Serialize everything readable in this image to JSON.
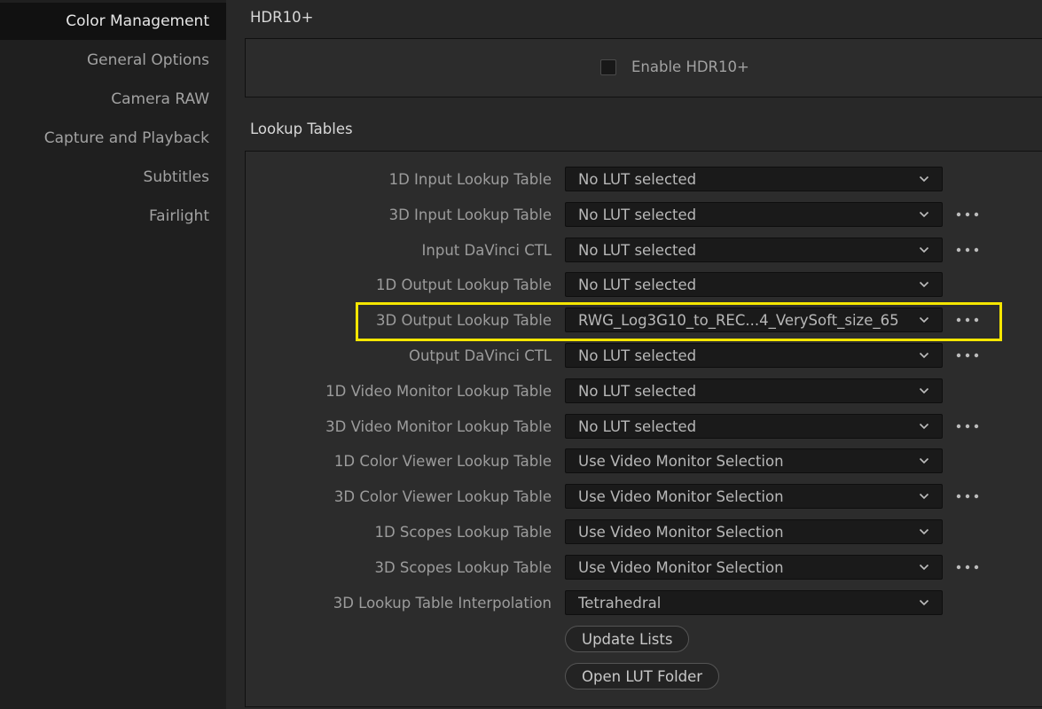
{
  "sidebar": {
    "items": [
      {
        "label": "Color Management",
        "active": true
      },
      {
        "label": "General Options"
      },
      {
        "label": "Camera RAW"
      },
      {
        "label": "Capture and Playback"
      },
      {
        "label": "Subtitles"
      },
      {
        "label": "Fairlight"
      }
    ]
  },
  "hdr": {
    "title": "HDR10+",
    "checkbox_label": "Enable HDR10+",
    "checked": false
  },
  "lut": {
    "title": "Lookup Tables",
    "rows": [
      {
        "label": "1D Input Lookup Table",
        "value": "No LUT selected",
        "has_more": false
      },
      {
        "label": "3D Input Lookup Table",
        "value": "No LUT selected",
        "has_more": true
      },
      {
        "label": "Input DaVinci CTL",
        "value": "No LUT selected",
        "has_more": true
      },
      {
        "label": "1D Output Lookup Table",
        "value": "No LUT selected",
        "has_more": false
      },
      {
        "label": "3D Output Lookup Table",
        "value": "RWG_Log3G10_to_REC...4_VerySoft_size_65",
        "has_more": true,
        "highlighted": true
      },
      {
        "label": "Output DaVinci CTL",
        "value": "No LUT selected",
        "has_more": true
      },
      {
        "label": "1D Video Monitor Lookup Table",
        "value": "No LUT selected",
        "has_more": false
      },
      {
        "label": "3D Video Monitor Lookup Table",
        "value": "No LUT selected",
        "has_more": true
      },
      {
        "label": "1D Color Viewer Lookup Table",
        "value": "Use Video Monitor Selection",
        "has_more": false
      },
      {
        "label": "3D Color Viewer Lookup Table",
        "value": "Use Video Monitor Selection",
        "has_more": true
      },
      {
        "label": "1D Scopes Lookup Table",
        "value": "Use Video Monitor Selection",
        "has_more": false
      },
      {
        "label": "3D Scopes Lookup Table",
        "value": "Use Video Monitor Selection",
        "has_more": true
      },
      {
        "label": "3D Lookup Table Interpolation",
        "value": "Tetrahedral",
        "has_more": false
      }
    ],
    "update_button": "Update Lists",
    "open_folder_button": "Open LUT Folder"
  },
  "colors": {
    "highlight": "#f5e600",
    "panel_bg": "#2c2c2c",
    "sidebar_active_bg": "#111111"
  },
  "icons": {
    "dropdown": "chevron-down-icon",
    "more": "more-horizontal-icon"
  }
}
